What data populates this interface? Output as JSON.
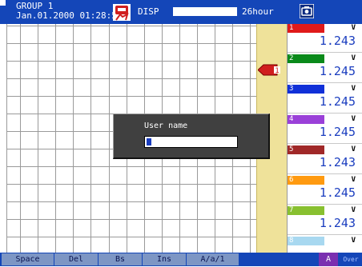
{
  "header": {
    "group": "GROUP 1",
    "datetime": "Jan.01.2000 01:28:56",
    "disp_label": "DISP",
    "time_span": "26hour",
    "icons": {
      "alarm": "alarm-icon",
      "camera": "camera-icon"
    }
  },
  "marker": {
    "label": "1",
    "icon": "marker-arrow-icon",
    "color": "#d01e1e"
  },
  "channels": [
    {
      "num": "1",
      "unit": "V",
      "value": "1.243",
      "color": "#e01a1a"
    },
    {
      "num": "2",
      "unit": "V",
      "value": "1.245",
      "color": "#0a8a1a"
    },
    {
      "num": "3",
      "unit": "V",
      "value": "1.245",
      "color": "#1030d8"
    },
    {
      "num": "4",
      "unit": "V",
      "value": "1.245",
      "color": "#9a40d8"
    },
    {
      "num": "5",
      "unit": "V",
      "value": "1.243",
      "color": "#a02828"
    },
    {
      "num": "6",
      "unit": "V",
      "value": "1.245",
      "color": "#ff9a10"
    },
    {
      "num": "7",
      "unit": "V",
      "value": "1.243",
      "color": "#88c030"
    },
    {
      "num": "8",
      "unit": "V",
      "value": "",
      "color": "#a8d8f0"
    }
  ],
  "dialog": {
    "title": "User name",
    "value": ""
  },
  "softkeys": [
    {
      "label": "Space"
    },
    {
      "label": "Del"
    },
    {
      "label": "Bs"
    },
    {
      "label": "Ins"
    },
    {
      "label": "A/a/1"
    }
  ],
  "mode": {
    "input_mode": "A",
    "over_label": "Over"
  },
  "colors": {
    "header_bg": "#1446b8",
    "scale_strip": "#efe29a",
    "value_text": "#1a3dbf",
    "dialog_bg": "#404040"
  }
}
